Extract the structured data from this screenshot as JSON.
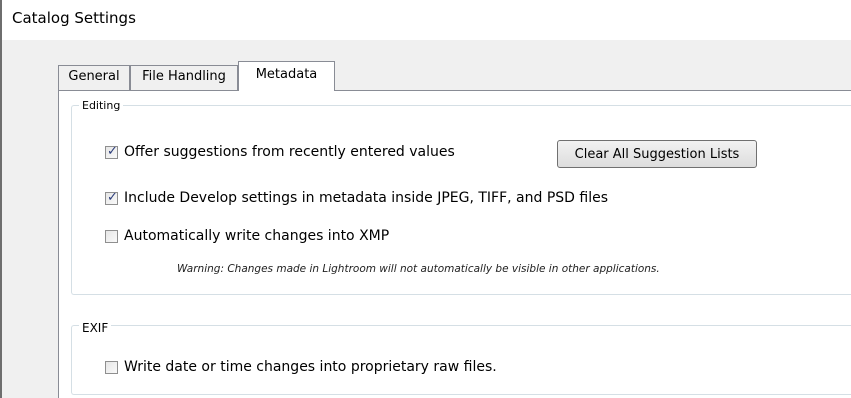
{
  "window": {
    "title": "Catalog Settings"
  },
  "tabs": [
    {
      "label": "General",
      "active": false
    },
    {
      "label": "File Handling",
      "active": false
    },
    {
      "label": "Metadata",
      "active": true
    }
  ],
  "editing": {
    "legend": "Editing",
    "offer_suggestions": {
      "label": "Offer suggestions from recently entered values",
      "checked": true
    },
    "clear_button": "Clear All Suggestion Lists",
    "include_develop": {
      "label": "Include Develop settings in metadata inside JPEG, TIFF, and PSD files",
      "checked": true
    },
    "auto_write_xmp": {
      "label": "Automatically write changes into XMP",
      "checked": false
    },
    "warning": "Warning: Changes made in Lightroom will not automatically be visible in other applications."
  },
  "exif": {
    "legend": "EXIF",
    "write_date": {
      "label": "Write date or time changes into proprietary raw files.",
      "checked": false
    }
  },
  "colors": {
    "tab_border": "#898c95",
    "dialog_bg": "#f0f0f0",
    "check_mark": "#2b3c7a"
  }
}
